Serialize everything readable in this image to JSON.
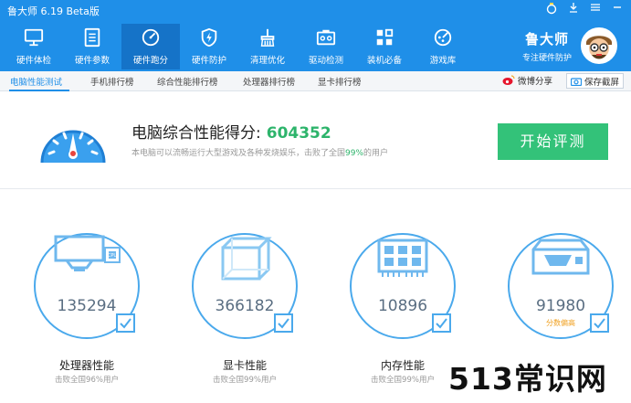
{
  "app": {
    "title": "鲁大师 6.19 Beta版"
  },
  "nav": {
    "items": [
      {
        "label": "硬件体检",
        "icon": "monitor-icon"
      },
      {
        "label": "硬件参数",
        "icon": "document-list-icon"
      },
      {
        "label": "硬件跑分",
        "icon": "speedometer-icon"
      },
      {
        "label": "硬件防护",
        "icon": "shield-bolt-icon"
      },
      {
        "label": "清理优化",
        "icon": "broom-icon"
      },
      {
        "label": "驱动检测",
        "icon": "driver-chip-icon"
      },
      {
        "label": "装机必备",
        "icon": "apps-grid-icon"
      },
      {
        "label": "游戏库",
        "icon": "gamepad-icon"
      }
    ],
    "active_index": 2
  },
  "brand": {
    "title": "鲁大师",
    "subtitle": "专注硬件防护"
  },
  "subtabs": {
    "items": [
      "电脑性能测试",
      "手机排行榜",
      "综合性能排行榜",
      "处理器排行榜",
      "显卡排行榜"
    ],
    "share_label": "微博分享",
    "save_label": "保存截屏"
  },
  "score": {
    "title": "电脑综合性能得分:",
    "value": "604352",
    "desc_before": "本电脑可以流畅运行大型游戏及各种发烧娱乐，击败了全国",
    "desc_pct": "99%",
    "desc_after": "的用户",
    "button": "开始评测"
  },
  "cards": [
    {
      "value": "135294",
      "name": "处理器性能",
      "sub": "击败全国96%用户",
      "note": ""
    },
    {
      "value": "366182",
      "name": "显卡性能",
      "sub": "击败全国99%用户",
      "note": ""
    },
    {
      "value": "10896",
      "name": "内存性能",
      "sub": "击败全国99%用户",
      "note": ""
    },
    {
      "value": "91980",
      "name": "",
      "sub": "",
      "note": "分数偏高"
    }
  ],
  "watermark": "513常识网",
  "colors": {
    "header_blue": "#1f8fe8",
    "active_blue": "#1573c8",
    "score_green": "#2db46b",
    "button_green": "#33c279",
    "circle_blue": "#4aa9ec"
  }
}
